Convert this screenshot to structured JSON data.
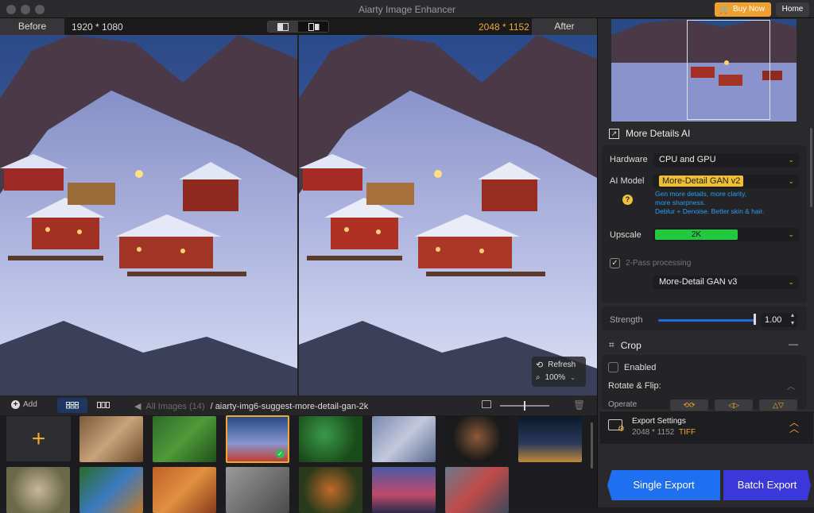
{
  "window": {
    "title": "Aiarty Image Enhancer",
    "buy_now": "Buy Now",
    "home": "Home"
  },
  "compare": {
    "before_label": "Before",
    "after_label": "After",
    "before_res": "1920 * 1080",
    "after_res": "2048 * 1152",
    "after_res_color": "#f0a830"
  },
  "zoom": {
    "refresh": "Refresh",
    "level": "100%"
  },
  "toolbar": {
    "add": "Add",
    "breadcrumb_root": "All Images (14)",
    "breadcrumb_current": "/ aiarty-img6-suggest-more-detail-gan-2k"
  },
  "panel": {
    "section_title": "More Details AI",
    "hardware_label": "Hardware",
    "hardware_value": "CPU and GPU",
    "model_label": "AI Model",
    "model_value": "More-Detail GAN  v2",
    "model_hint": [
      "Gen more details, more clarity,",
      "more sharpness.",
      "Deblur + Denoise. Better skin & hair."
    ],
    "upscale_label": "Upscale",
    "upscale_value": "2K",
    "upscale_fill_fraction": 0.58,
    "two_pass_label": "2-Pass processing",
    "two_pass_checked": true,
    "two_pass_model": "More-Detail GAN  v3",
    "strength_label": "Strength",
    "strength_value": "1.00",
    "strength_fraction": 1.0,
    "crop_title": "Crop",
    "crop_enabled_label": "Enabled",
    "crop_enabled": false,
    "rotate_label": "Rotate & Flip:",
    "operate_label": "Operate",
    "export_title": "Export Settings",
    "export_res": "2048 * 1152",
    "export_format": "TIFF",
    "single_export": "Single Export",
    "batch_export": "Batch Export"
  },
  "colors": {
    "accent_orange": "#f0a830",
    "accent_blue": "#1f6ff0",
    "upscale_green": "#22c940"
  }
}
